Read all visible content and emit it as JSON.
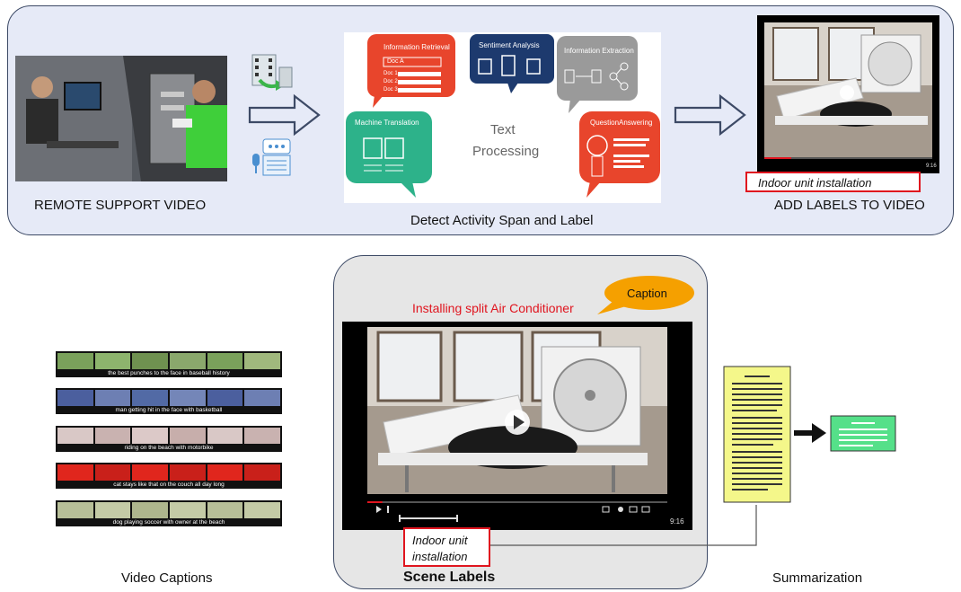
{
  "top": {
    "remote_label": "REMOTE SUPPORT VIDEO",
    "detect_label": "Detect Activity Span and Label",
    "add_labels_label": "ADD LABELS TO VIDEO",
    "indoor_label": "Indoor unit installation",
    "text_processing": {
      "center_line1": "Text",
      "center_line2": "Processing",
      "bubbles": {
        "information_retrieval": "Information Retrieval",
        "doc_a": "Doc A",
        "doc1": "Doc 1",
        "doc2": "Doc 2",
        "doc3": "Doc 3",
        "sentiment": "Sentiment Analysis",
        "info_extraction": "Information Extraction",
        "machine_translation": "Machine Translation",
        "question_answering": "QuestionAnswering"
      }
    },
    "small_video_time": "9:16"
  },
  "bottom": {
    "video_captions_label": "Video Captions",
    "scene_labels_label": "Scene Labels",
    "summarization_label": "Summarization",
    "caption_bubble": "Caption",
    "video_title": "Installing split Air Conditioner",
    "indoor_line1": "Indoor unit",
    "indoor_line2": "installation",
    "player_time": "9:16",
    "player_progress": 0.05,
    "captions": [
      "the best punches to the face in baseball history",
      "man getting hit in the face with basketball",
      "riding on the beach with motorbike",
      "cat stays like that on the couch all day long",
      "dog playing soccer with owner at the beach"
    ]
  },
  "colors": {
    "panel_fill": "#e6eaf7",
    "panel_border": "#3d4a66",
    "accent_red": "#e0151f",
    "caption_orange": "#f5a000",
    "summary_yellow": "#f4f78a",
    "summary_green": "#55e089",
    "ir_bubble": "#e8452c",
    "sentiment_bubble": "#1d3a6e",
    "extraction_bubble": "#9a9a9a",
    "translation_bubble": "#2db28a",
    "qa_bubble": "#e8452c"
  }
}
